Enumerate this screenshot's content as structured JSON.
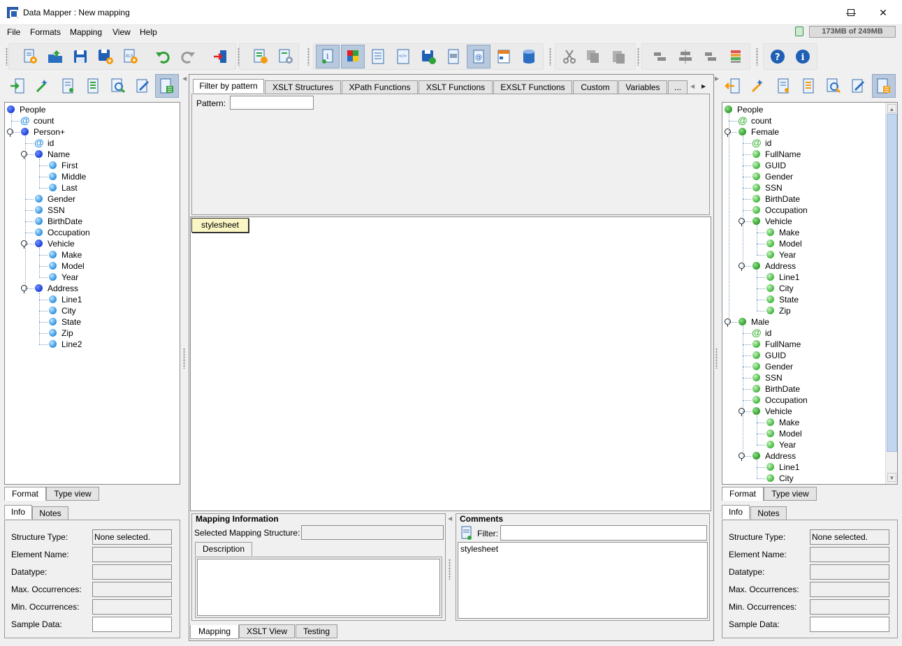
{
  "window": {
    "title": "Data Mapper : New mapping"
  },
  "menu": [
    "File",
    "Formats",
    "Mapping",
    "View",
    "Help"
  ],
  "memory": "173MB of 249MB",
  "toolbar": {
    "buttons": [
      "new-mapping-icon",
      "open-icon",
      "save-icon",
      "save-as-icon",
      "export-xls-icon",
      "undo-icon",
      "redo-icon",
      "exit-icon",
      "add-format-icon",
      "format-settings-icon",
      "info-view-icon",
      "color-map-icon",
      "checklist-icon",
      "xslt-code-icon",
      "save-db-icon",
      "print-icon",
      "attribute-icon",
      "table-icon",
      "database-icon",
      "cut-icon",
      "copy-icon",
      "paste-icon",
      "align-left-icon",
      "align-center-icon",
      "align-right-icon",
      "layers-icon",
      "help-icon",
      "about-icon"
    ]
  },
  "source_tree": [
    {
      "label": "People",
      "type": "element",
      "level": 0
    },
    {
      "label": "count",
      "type": "attribute",
      "level": 1
    },
    {
      "label": "Person+",
      "type": "element",
      "level": 1,
      "expanded": true
    },
    {
      "label": "id",
      "type": "attribute",
      "level": 2
    },
    {
      "label": "Name",
      "type": "element",
      "level": 2,
      "expanded": true
    },
    {
      "label": "First",
      "type": "leaf",
      "level": 3
    },
    {
      "label": "Middle",
      "type": "leaf",
      "level": 3
    },
    {
      "label": "Last",
      "type": "leaf",
      "level": 3
    },
    {
      "label": "Gender",
      "type": "leaf",
      "level": 2
    },
    {
      "label": "SSN",
      "type": "leaf",
      "level": 2
    },
    {
      "label": "BirthDate",
      "type": "leaf",
      "level": 2
    },
    {
      "label": "Occupation",
      "type": "leaf",
      "level": 2
    },
    {
      "label": "Vehicle",
      "type": "element",
      "level": 2,
      "expanded": true
    },
    {
      "label": "Make",
      "type": "leaf",
      "level": 3
    },
    {
      "label": "Model",
      "type": "leaf",
      "level": 3
    },
    {
      "label": "Year",
      "type": "leaf",
      "level": 3
    },
    {
      "label": "Address",
      "type": "element",
      "level": 2,
      "expanded": true
    },
    {
      "label": "Line1",
      "type": "leaf",
      "level": 3
    },
    {
      "label": "City",
      "type": "leaf",
      "level": 3
    },
    {
      "label": "State",
      "type": "leaf",
      "level": 3
    },
    {
      "label": "Zip",
      "type": "leaf",
      "level": 3
    },
    {
      "label": "Line2",
      "type": "leaf",
      "level": 3
    }
  ],
  "target_tree": [
    {
      "label": "People",
      "type": "element",
      "level": 0
    },
    {
      "label": "count",
      "type": "attribute",
      "level": 1
    },
    {
      "label": "Female",
      "type": "element",
      "level": 1,
      "expanded": true
    },
    {
      "label": "id",
      "type": "attribute",
      "level": 2
    },
    {
      "label": "FullName",
      "type": "leaf",
      "level": 2
    },
    {
      "label": "GUID",
      "type": "leaf",
      "level": 2
    },
    {
      "label": "Gender",
      "type": "leaf",
      "level": 2
    },
    {
      "label": "SSN",
      "type": "leaf",
      "level": 2
    },
    {
      "label": "BirthDate",
      "type": "leaf",
      "level": 2
    },
    {
      "label": "Occupation",
      "type": "leaf",
      "level": 2
    },
    {
      "label": "Vehicle",
      "type": "element",
      "level": 2,
      "expanded": true
    },
    {
      "label": "Make",
      "type": "leaf",
      "level": 3
    },
    {
      "label": "Model",
      "type": "leaf",
      "level": 3
    },
    {
      "label": "Year",
      "type": "leaf",
      "level": 3
    },
    {
      "label": "Address",
      "type": "element",
      "level": 2,
      "expanded": true
    },
    {
      "label": "Line1",
      "type": "leaf",
      "level": 3
    },
    {
      "label": "City",
      "type": "leaf",
      "level": 3
    },
    {
      "label": "State",
      "type": "leaf",
      "level": 3
    },
    {
      "label": "Zip",
      "type": "leaf",
      "level": 3
    },
    {
      "label": "Male",
      "type": "element",
      "level": 1,
      "expanded": true
    },
    {
      "label": "id",
      "type": "attribute",
      "level": 2
    },
    {
      "label": "FullName",
      "type": "leaf",
      "level": 2
    },
    {
      "label": "GUID",
      "type": "leaf",
      "level": 2
    },
    {
      "label": "Gender",
      "type": "leaf",
      "level": 2
    },
    {
      "label": "SSN",
      "type": "leaf",
      "level": 2
    },
    {
      "label": "BirthDate",
      "type": "leaf",
      "level": 2
    },
    {
      "label": "Occupation",
      "type": "leaf",
      "level": 2
    },
    {
      "label": "Vehicle",
      "type": "element",
      "level": 2,
      "expanded": true
    },
    {
      "label": "Make",
      "type": "leaf",
      "level": 3
    },
    {
      "label": "Model",
      "type": "leaf",
      "level": 3
    },
    {
      "label": "Year",
      "type": "leaf",
      "level": 3
    },
    {
      "label": "Address",
      "type": "element",
      "level": 2,
      "expanded": true
    },
    {
      "label": "Line1",
      "type": "leaf",
      "level": 3
    },
    {
      "label": "City",
      "type": "leaf",
      "level": 3
    }
  ],
  "left_panel": {
    "tabs": [
      "Format",
      "Type view"
    ],
    "info_tabs": [
      "Info",
      "Notes"
    ],
    "fields": [
      {
        "label": "Structure Type:",
        "value": "None selected."
      },
      {
        "label": "Element Name:",
        "value": ""
      },
      {
        "label": "Datatype:",
        "value": ""
      },
      {
        "label": "Max. Occurrences:",
        "value": ""
      },
      {
        "label": "Min. Occurrences:",
        "value": ""
      },
      {
        "label": "Sample Data:",
        "value": ""
      }
    ]
  },
  "right_panel": {
    "tabs": [
      "Format",
      "Type view"
    ],
    "info_tabs": [
      "Info",
      "Notes"
    ],
    "fields": [
      {
        "label": "Structure Type:",
        "value": "None selected."
      },
      {
        "label": "Element Name:",
        "value": ""
      },
      {
        "label": "Datatype:",
        "value": ""
      },
      {
        "label": "Max. Occurrences:",
        "value": ""
      },
      {
        "label": "Min. Occurrences:",
        "value": ""
      },
      {
        "label": "Sample Data:",
        "value": ""
      }
    ]
  },
  "center": {
    "function_tabs": [
      "Filter by pattern",
      "XSLT Structures",
      "XPath Functions",
      "XSLT Functions",
      "EXSLT Functions",
      "Custom",
      "Variables",
      "..."
    ],
    "pattern_label": "Pattern:",
    "pattern_value": "",
    "stylesheet_node": "stylesheet",
    "mapping_info_title": "Mapping Information",
    "selected_structure_label": "Selected Mapping Structure:",
    "description_tab": "Description",
    "comments_title": "Comments",
    "filter_label": "Filter:",
    "comments_item": "stylesheet",
    "bottom_tabs": [
      "Mapping",
      "XSLT View",
      "Testing"
    ]
  }
}
